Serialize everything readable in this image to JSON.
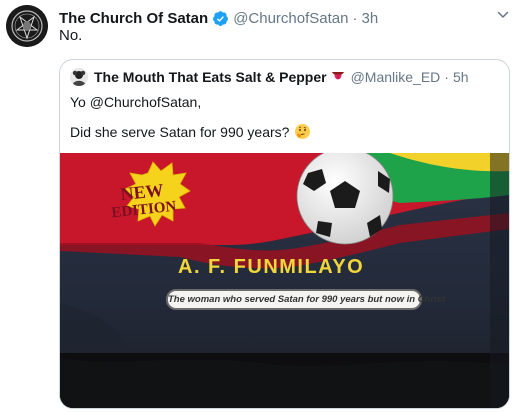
{
  "tweet": {
    "author_name": "The Church Of Satan",
    "handle": "@ChurchofSatan",
    "separator": "·",
    "time": "3h",
    "text": "No."
  },
  "quoted_tweet": {
    "author_name": "The Mouth That Eats Salt & Pepper",
    "name_emoji": "tongue-emoji",
    "handle": "@Manlike_ED",
    "separator": "·",
    "time": "5h",
    "line1": "Yo @ChurchofSatan,",
    "line2": "Did she serve Satan for 990 years?",
    "line2_emoji": "thinking-face-emoji",
    "media": {
      "badge_line1": "NEW",
      "badge_line2": "EDITION",
      "author_on_cover": "A. F. FUNMILAYO",
      "subtitle_on_cover": "The woman who served Satan for 990 years but now in Christ"
    }
  },
  "colors": {
    "verified_blue": "#1da1f2",
    "secondary_text": "#657786",
    "border": "#ccd6dd",
    "cover_author_yellow": "#f0d63a",
    "badge_yellow": "#f5d21b"
  }
}
